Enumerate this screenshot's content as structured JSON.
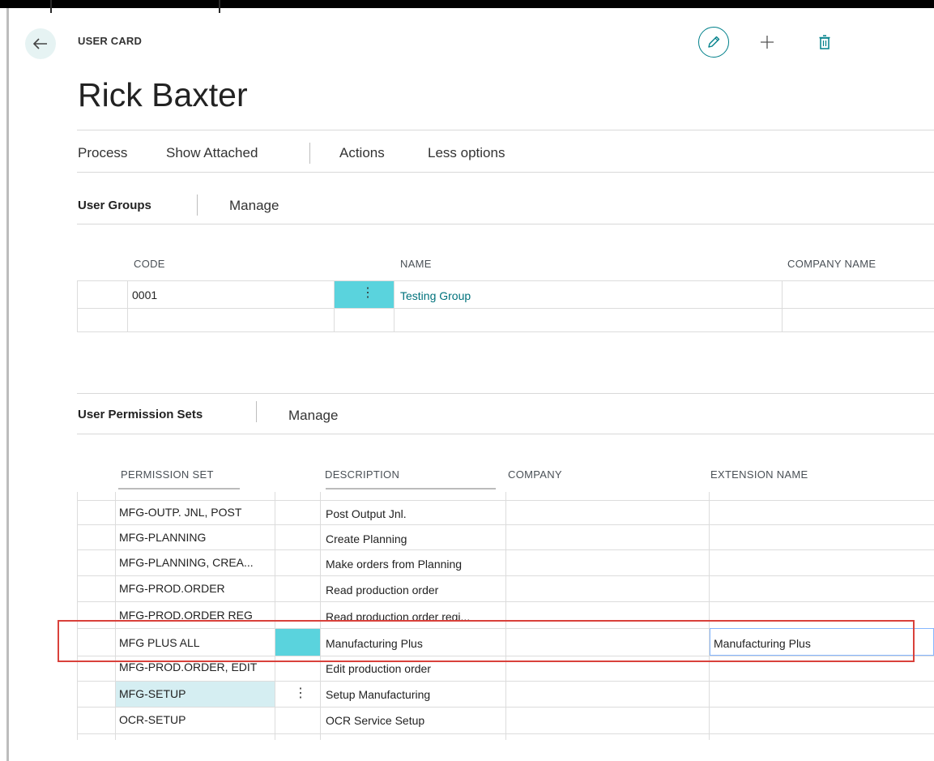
{
  "header": {
    "card_label": "USER CARD",
    "title": "Rick Baxter",
    "icons": [
      "back-arrow-icon",
      "pencil-icon",
      "plus-icon",
      "trash-icon"
    ]
  },
  "action_bar": {
    "items": [
      "Process",
      "Show Attached",
      "Actions",
      "Less options"
    ]
  },
  "user_groups": {
    "title": "User Groups",
    "manage_label": "Manage",
    "columns": [
      "CODE",
      "NAME",
      "COMPANY NAME"
    ],
    "rows": [
      {
        "code": "0001",
        "name": "Testing Group",
        "company_name": ""
      }
    ]
  },
  "permission_sets": {
    "title": "User Permission Sets",
    "manage_label": "Manage",
    "columns": [
      "PERMISSION SET",
      "DESCRIPTION",
      "COMPANY",
      "EXTENSION NAME"
    ],
    "rows": [
      {
        "permission_set": "MFG-OUTP. JNL, POST",
        "description": "Post Output Jnl.",
        "company": "",
        "extension": ""
      },
      {
        "permission_set": "MFG-PLANNING",
        "description": "Create Planning",
        "company": "",
        "extension": ""
      },
      {
        "permission_set": "MFG-PLANNING, CREA...",
        "description": "Make orders from Planning",
        "company": "",
        "extension": ""
      },
      {
        "permission_set": "MFG-PROD.ORDER",
        "description": "Read production order",
        "company": "",
        "extension": ""
      },
      {
        "permission_set": "MFG-PROD.ORDER REG",
        "description": "Read production order regi...",
        "company": "",
        "extension": ""
      },
      {
        "permission_set": "MFG PLUS ALL",
        "description": "Manufacturing Plus",
        "company": "",
        "extension": "Manufacturing Plus"
      },
      {
        "permission_set": "MFG-PROD.ORDER, EDIT",
        "description": "Edit production order",
        "company": "",
        "extension": ""
      },
      {
        "permission_set": "MFG-SETUP",
        "description": "Setup Manufacturing",
        "company": "",
        "extension": ""
      },
      {
        "permission_set": "OCR-SETUP",
        "description": "OCR Service Setup",
        "company": "",
        "extension": ""
      }
    ]
  },
  "colors": {
    "accent": "#00808a",
    "selected_cell": "#5ad3dd",
    "highlight_box": "#d9413b",
    "link": "#00727c"
  }
}
